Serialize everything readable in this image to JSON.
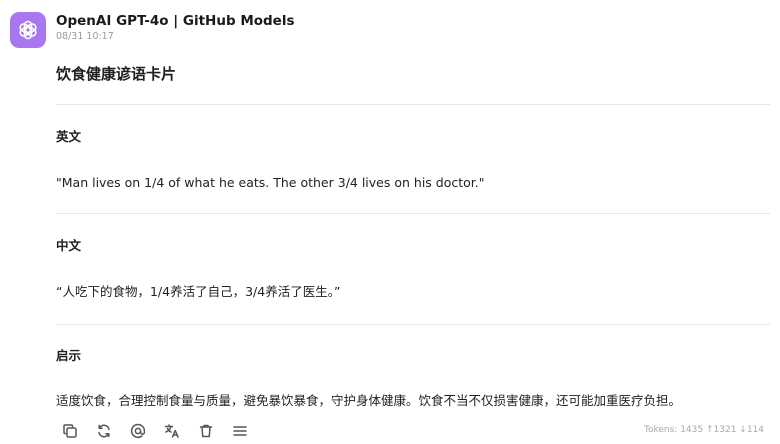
{
  "message": {
    "model_name": "OpenAI GPT-4o | GitHub Models",
    "timestamp": "08/31 10:17",
    "avatar_icon": "openai-logo-icon",
    "avatar_color": "#a978f0"
  },
  "card": {
    "title": "饮食健康谚语卡片",
    "sections": [
      {
        "heading": "英文",
        "body": "\"Man lives on 1/4 of what he eats. The other 3/4 lives on his doctor.\""
      },
      {
        "heading": "中文",
        "body": "“人吃下的食物，1/4养活了自己，3/4养活了医生。”"
      },
      {
        "heading": "启示",
        "body": "适度饮食，合理控制食量与质量，避免暴饮暴食，守护身体健康。饮食不当不仅损害健康，还可能加重医疗负担。"
      }
    ]
  },
  "toolbar": {
    "icons": [
      "copy-icon",
      "regenerate-icon",
      "mention-icon",
      "translate-icon",
      "delete-icon",
      "menu-icon"
    ]
  },
  "tokens": {
    "text": "Tokens: 1435 ↑1321 ↓114"
  }
}
